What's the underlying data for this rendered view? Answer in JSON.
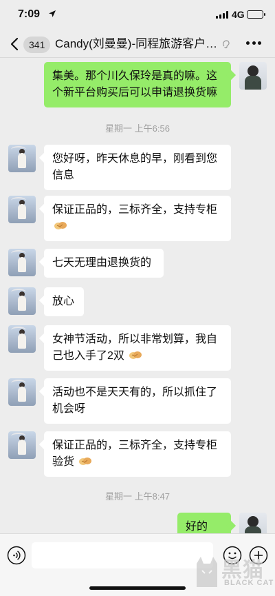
{
  "status_bar": {
    "time": "7:09",
    "network": "4G"
  },
  "nav": {
    "unread_count": "341",
    "title": "Candy(刘曼曼)-同程旅游客户…",
    "icons": [
      "back-arrow-icon",
      "mute-ear-icon",
      "more-dots-icon"
    ]
  },
  "messages": [
    {
      "side": "right",
      "text": "集美。那个川久保玲是真的嘛。这个新平台购买后可以申请退换货嘛",
      "emoji": ""
    },
    {
      "type": "time",
      "text": "星期一 上午6:56"
    },
    {
      "side": "left",
      "text": "您好呀，昨天休息的早，刚看到您信息",
      "emoji": ""
    },
    {
      "side": "left",
      "text": "保证正品的，三标齐全，支持专柜",
      "emoji": "handshake"
    },
    {
      "side": "left",
      "text": "七天无理由退换货的",
      "emoji": ""
    },
    {
      "side": "left",
      "text": "放心",
      "emoji": ""
    },
    {
      "side": "left",
      "text": "女神节活动，所以非常划算，我自己也入手了2双",
      "emoji": "handshake"
    },
    {
      "side": "left",
      "text": "活动也不是天天有的，所以抓住了机会呀",
      "emoji": ""
    },
    {
      "side": "left",
      "text": "保证正品的，三标齐全，支持专柜验货",
      "emoji": "handshake"
    },
    {
      "type": "time",
      "text": "星期一 上午8:47"
    },
    {
      "side": "right",
      "text": "好的",
      "emoji": "ok-hand"
    }
  ],
  "input_bar": {
    "icons": [
      "voice-icon",
      "emoji-icon",
      "plus-icon"
    ]
  },
  "watermark": {
    "cn": "黑猫",
    "en": "BLACK CAT"
  },
  "colors": {
    "background": "#ededed",
    "bubble_self": "#95ec69",
    "bubble_other": "#ffffff",
    "timestamp": "#a0a0a0"
  }
}
